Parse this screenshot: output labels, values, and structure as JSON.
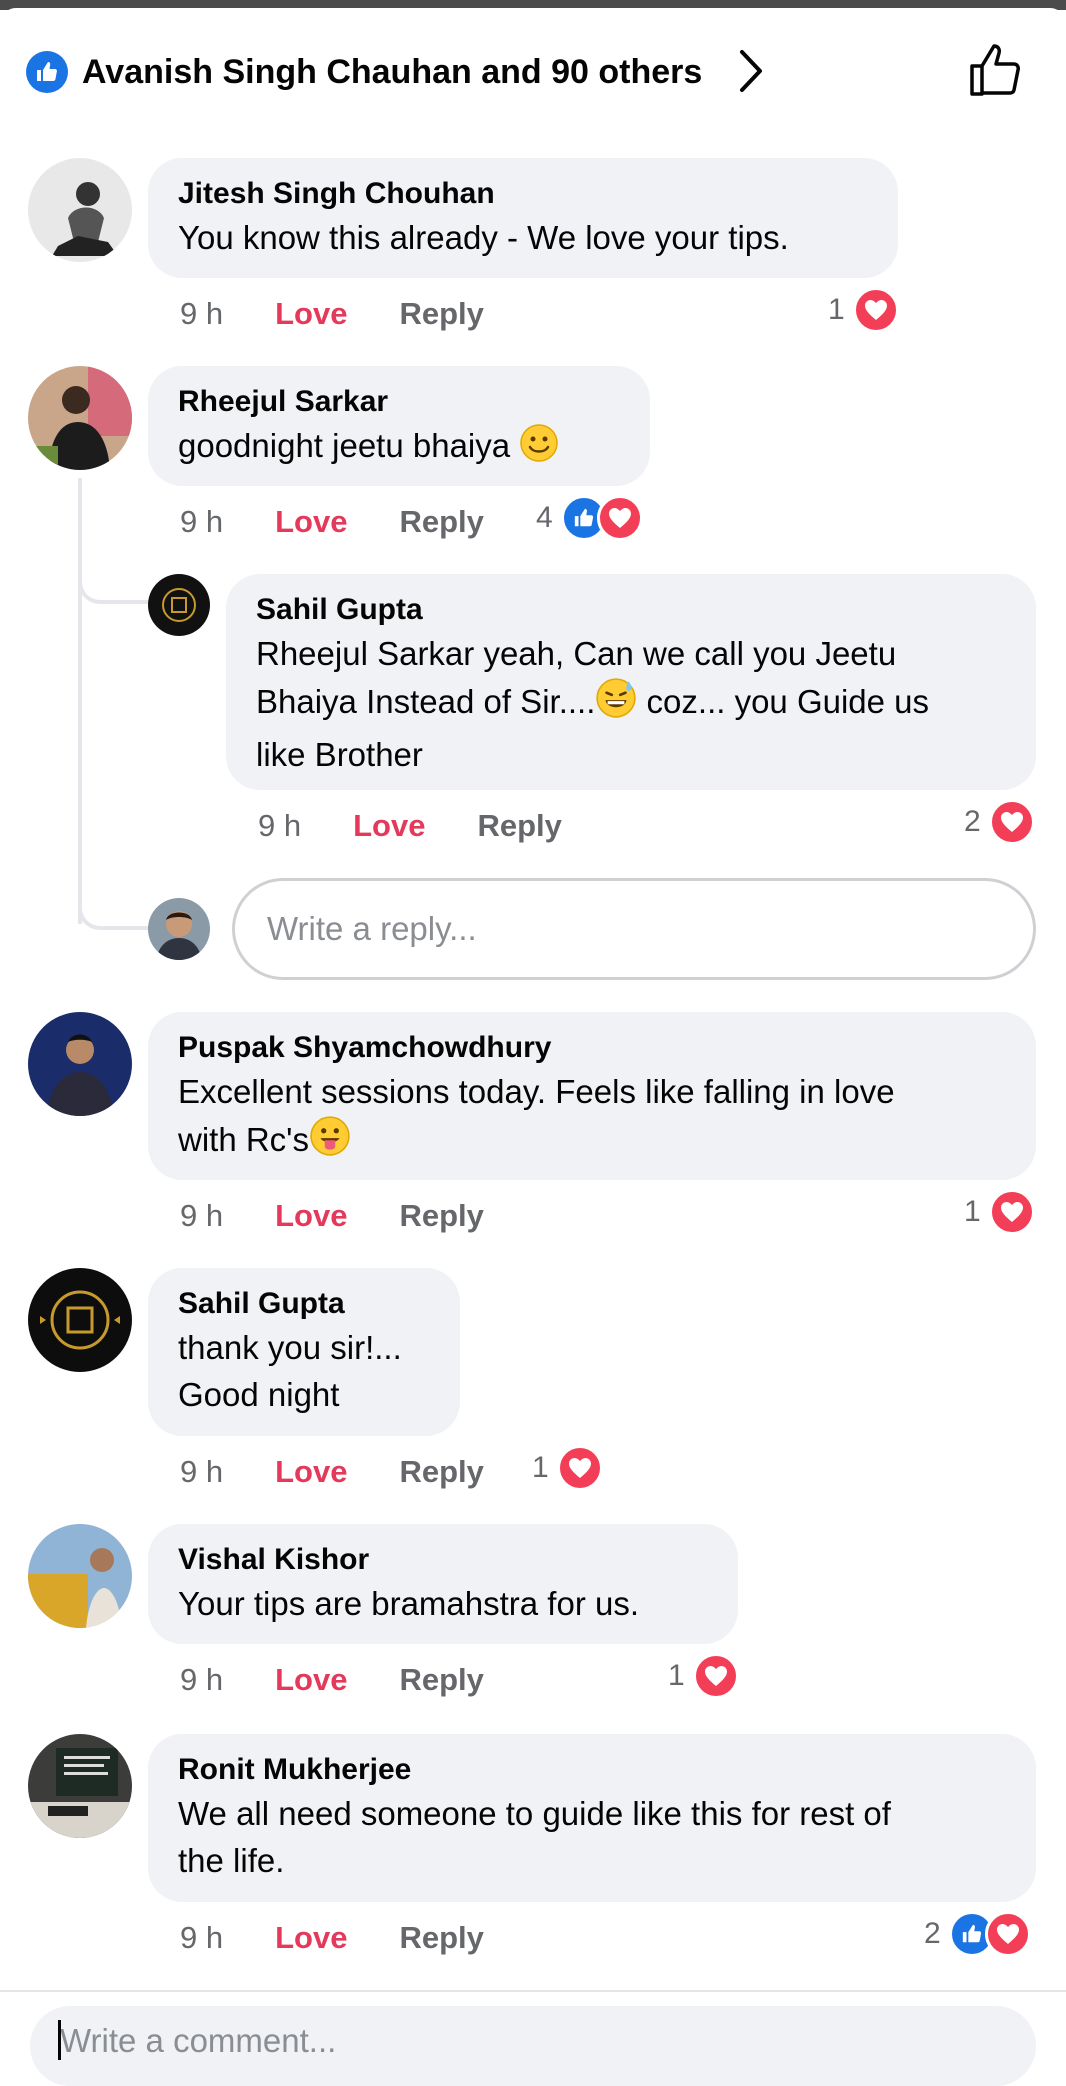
{
  "header": {
    "reactors_text": "Avanish Singh Chauhan and 90 others"
  },
  "colors": {
    "like_blue": "#1b74e4",
    "love_red": "#f33e58",
    "love_text": "#e4395a",
    "bubble_bg": "#f0f2f5",
    "muted": "#65676b"
  },
  "comments": [
    {
      "author": "Jitesh Singh Chouhan",
      "text": "You know this already - We love your tips.",
      "time": "9 h",
      "love": "Love",
      "reply": "Reply",
      "react_count": "1",
      "reactions": [
        "love"
      ]
    },
    {
      "author": "Rheejul Sarkar",
      "text": "goodnight jeetu bhaiya",
      "time": "9 h",
      "love": "Love",
      "reply": "Reply",
      "react_count": "4",
      "reactions": [
        "like",
        "love"
      ]
    },
    {
      "author": "Sahil Gupta",
      "text_1": "Rheejul Sarkar  yeah,  Can we call you Jeetu",
      "text_2": "Bhaiya Instead of Sir....",
      "text_2b": " coz... you Guide us",
      "text_3": "like Brother",
      "time": "9 h",
      "love": "Love",
      "reply": "Reply",
      "react_count": "2",
      "reactions": [
        "love"
      ]
    },
    {
      "author": "Puspak Shyamchowdhury",
      "text_1": "Excellent sessions today. Feels like falling in love",
      "text_2": "with Rc's",
      "time": "9 h",
      "love": "Love",
      "reply": "Reply",
      "react_count": "1",
      "reactions": [
        "love"
      ]
    },
    {
      "author": "Sahil Gupta",
      "text_1": "thank you sir!...",
      "text_2": "Good night",
      "time": "9 h",
      "love": "Love",
      "reply": "Reply",
      "react_count": "1",
      "reactions": [
        "love"
      ]
    },
    {
      "author": "Vishal Kishor",
      "text": "Your tips are bramahstra for us.",
      "time": "9 h",
      "love": "Love",
      "reply": "Reply",
      "react_count": "1",
      "reactions": [
        "love"
      ]
    },
    {
      "author": "Ronit Mukherjee",
      "text_1": "We all need someone to guide like this for rest of",
      "text_2": "the life.",
      "time": "9 h",
      "love": "Love",
      "reply": "Reply",
      "react_count": "2",
      "reactions": [
        "like",
        "love"
      ]
    }
  ],
  "reply_input": {
    "placeholder": "Write a reply..."
  },
  "comment_input": {
    "placeholder": "Write a comment..."
  }
}
